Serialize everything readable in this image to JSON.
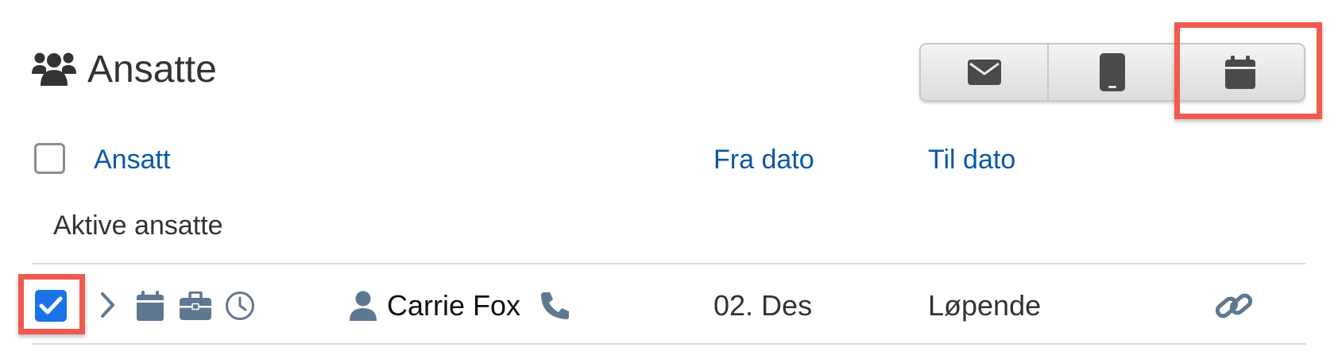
{
  "header": {
    "title": "Ansatte",
    "icon": "users-icon"
  },
  "toolbar": {
    "buttons": [
      {
        "name": "email-button",
        "icon": "envelope-icon"
      },
      {
        "name": "mobile-button",
        "icon": "mobile-phone-icon"
      },
      {
        "name": "calendar-button",
        "icon": "calendar-icon",
        "highlighted": true
      }
    ]
  },
  "table": {
    "columns": {
      "employee": "Ansatt",
      "from_date": "Fra dato",
      "to_date": "Til dato"
    },
    "group_label": "Aktive ansatte",
    "rows": [
      {
        "checked": true,
        "name": "Carrie Fox",
        "from_date": "02. Des",
        "to_date": "Løpende",
        "icons": [
          "chevron-right-icon",
          "calendar-icon",
          "briefcase-icon",
          "clock-icon",
          "person-icon",
          "phone-icon",
          "link-icon"
        ]
      }
    ]
  },
  "colors": {
    "link_blue": "#0b57a7",
    "checkbox_blue": "#1a73e8",
    "icon_slate": "#5f7891",
    "highlight_red": "#f15a4f"
  }
}
